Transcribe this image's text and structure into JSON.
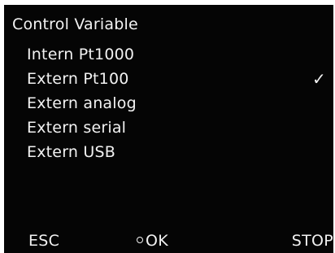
{
  "screen": {
    "title": "Control Variable",
    "menu": {
      "items": [
        {
          "label": "Intern Pt1000",
          "selected": false
        },
        {
          "label": "Extern Pt100",
          "selected": true
        },
        {
          "label": "Extern analog",
          "selected": false
        },
        {
          "label": "Extern serial",
          "selected": false
        },
        {
          "label": "Extern USB",
          "selected": false
        }
      ],
      "check_glyph": "✓"
    },
    "softkeys": {
      "esc": "ESC",
      "ok": "OK",
      "stop": "STOP"
    }
  },
  "colors": {
    "screen_background": "#050505",
    "text": "#f2f2f2"
  }
}
